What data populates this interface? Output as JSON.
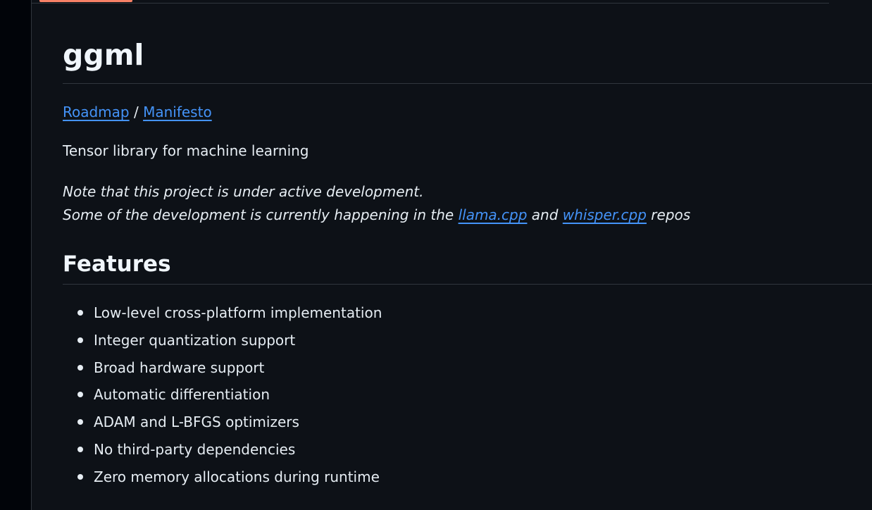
{
  "readme": {
    "title": "ggml",
    "nav": {
      "roadmap": "Roadmap",
      "separator": "/",
      "manifesto": "Manifesto"
    },
    "tagline": "Tensor library for machine learning",
    "note": {
      "line1": "Note that this project is under active development.",
      "line2_prefix": "Some of the development is currently happening in the",
      "link1": "llama.cpp",
      "and": "and",
      "link2": "whisper.cpp",
      "line2_suffix": "repos"
    },
    "features_heading": "Features",
    "features": [
      "Low-level cross-platform implementation",
      "Integer quantization support",
      "Broad hardware support",
      "Automatic differentiation",
      "ADAM and L-BFGS optimizers",
      "No third-party dependencies",
      "Zero memory allocations during runtime"
    ]
  },
  "colors": {
    "background": "#0d1117",
    "text": "#e6edf3",
    "link": "#4493f8",
    "rule": "#30363d",
    "tab_accent": "#f78166"
  }
}
